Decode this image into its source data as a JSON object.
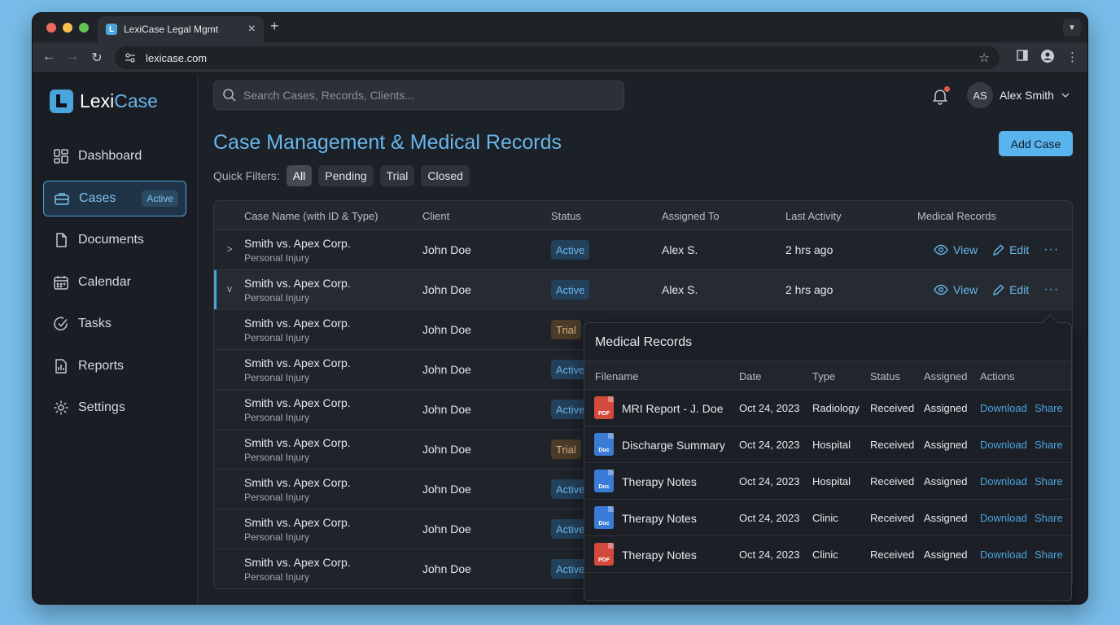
{
  "browser": {
    "tab_title": "LexiCase Legal Mgmt",
    "url": "lexicase.com",
    "colors": {
      "red": "#ed6a5e",
      "yellow": "#f5be4f",
      "green": "#61c454"
    }
  },
  "app": {
    "logo_prefix": "Lexi",
    "logo_accent": "Case",
    "search_placeholder": "Search Cases, Records, Clients...",
    "user": {
      "initials": "AS",
      "name": "Alex Smith"
    },
    "accent_color": "#4aa4de"
  },
  "sidebar": {
    "items": [
      {
        "label": "Dashboard",
        "icon": "grid-icon"
      },
      {
        "label": "Cases",
        "icon": "briefcase-icon",
        "badge": "Active",
        "active": true
      },
      {
        "label": "Documents",
        "icon": "document-icon"
      },
      {
        "label": "Calendar",
        "icon": "calendar-icon"
      },
      {
        "label": "Tasks",
        "icon": "check-circle-icon"
      },
      {
        "label": "Reports",
        "icon": "bar-chart-icon"
      },
      {
        "label": "Settings",
        "icon": "gear-icon"
      }
    ]
  },
  "main": {
    "title": "Case Management & Medical Records",
    "add_button": "Add Case",
    "filters_label": "Quick Filters:",
    "filters": [
      "All",
      "Pending",
      "Trial",
      "Closed"
    ],
    "columns": [
      "Case Name (with ID & Type)",
      "Client",
      "Status",
      "Assigned To",
      "Last Activity",
      "Medical Records"
    ],
    "view_label": "View",
    "edit_label": "Edit",
    "rows": [
      {
        "name": "Smith vs. Apex Corp.",
        "type": "Personal Injury",
        "client": "John Doe",
        "status": "Active",
        "assigned": "Alex S.",
        "last": "2 hrs ago"
      },
      {
        "name": "Smith vs. Apex Corp.",
        "type": "Personal Injury",
        "client": "John Doe",
        "status": "Active",
        "assigned": "Alex S.",
        "last": "2 hrs ago"
      },
      {
        "name": "Smith vs. Apex Corp.",
        "type": "Personal Injury",
        "client": "John Doe",
        "status": "Trial"
      },
      {
        "name": "Smith vs. Apex Corp.",
        "type": "Personal Injury",
        "client": "John Doe",
        "status": "Active"
      },
      {
        "name": "Smith vs. Apex Corp.",
        "type": "Personal Injury",
        "client": "John Doe",
        "status": "Active"
      },
      {
        "name": "Smith vs. Apex Corp.",
        "type": "Personal Injury",
        "client": "John Doe",
        "status": "Trial"
      },
      {
        "name": "Smith vs. Apex Corp.",
        "type": "Personal Injury",
        "client": "John Doe",
        "status": "Active"
      },
      {
        "name": "Smith vs. Apex Corp.",
        "type": "Personal Injury",
        "client": "John Doe",
        "status": "Active"
      },
      {
        "name": "Smith vs. Apex Corp.",
        "type": "Personal Injury",
        "client": "John Doe",
        "status": "Active"
      }
    ]
  },
  "popup": {
    "title": "Medical Records",
    "columns": [
      "Filename",
      "Date",
      "Type",
      "Status",
      "Assigned",
      "Actions"
    ],
    "download_label": "Download",
    "share_label": "Share",
    "records": [
      {
        "icon": "PDF",
        "filename": "MRI Report - J. Doe",
        "date": "Oct 24, 2023",
        "type": "Radiology",
        "status": "Received",
        "assigned": "Assigned"
      },
      {
        "icon": "Doc",
        "filename": "Discharge Summary",
        "date": "Oct 24, 2023",
        "type": "Hospital",
        "status": "Received",
        "assigned": "Assigned"
      },
      {
        "icon": "Doc",
        "filename": "Therapy Notes",
        "date": "Oct 24, 2023",
        "type": "Hospital",
        "status": "Received",
        "assigned": "Assigned"
      },
      {
        "icon": "Doc",
        "filename": "Therapy Notes",
        "date": "Oct 24, 2023",
        "type": "Clinic",
        "status": "Received",
        "assigned": "Assigned"
      },
      {
        "icon": "PDF",
        "filename": "Therapy Notes",
        "date": "Oct 24, 2023",
        "type": "Clinic",
        "status": "Received",
        "assigned": "Assigned"
      }
    ]
  }
}
